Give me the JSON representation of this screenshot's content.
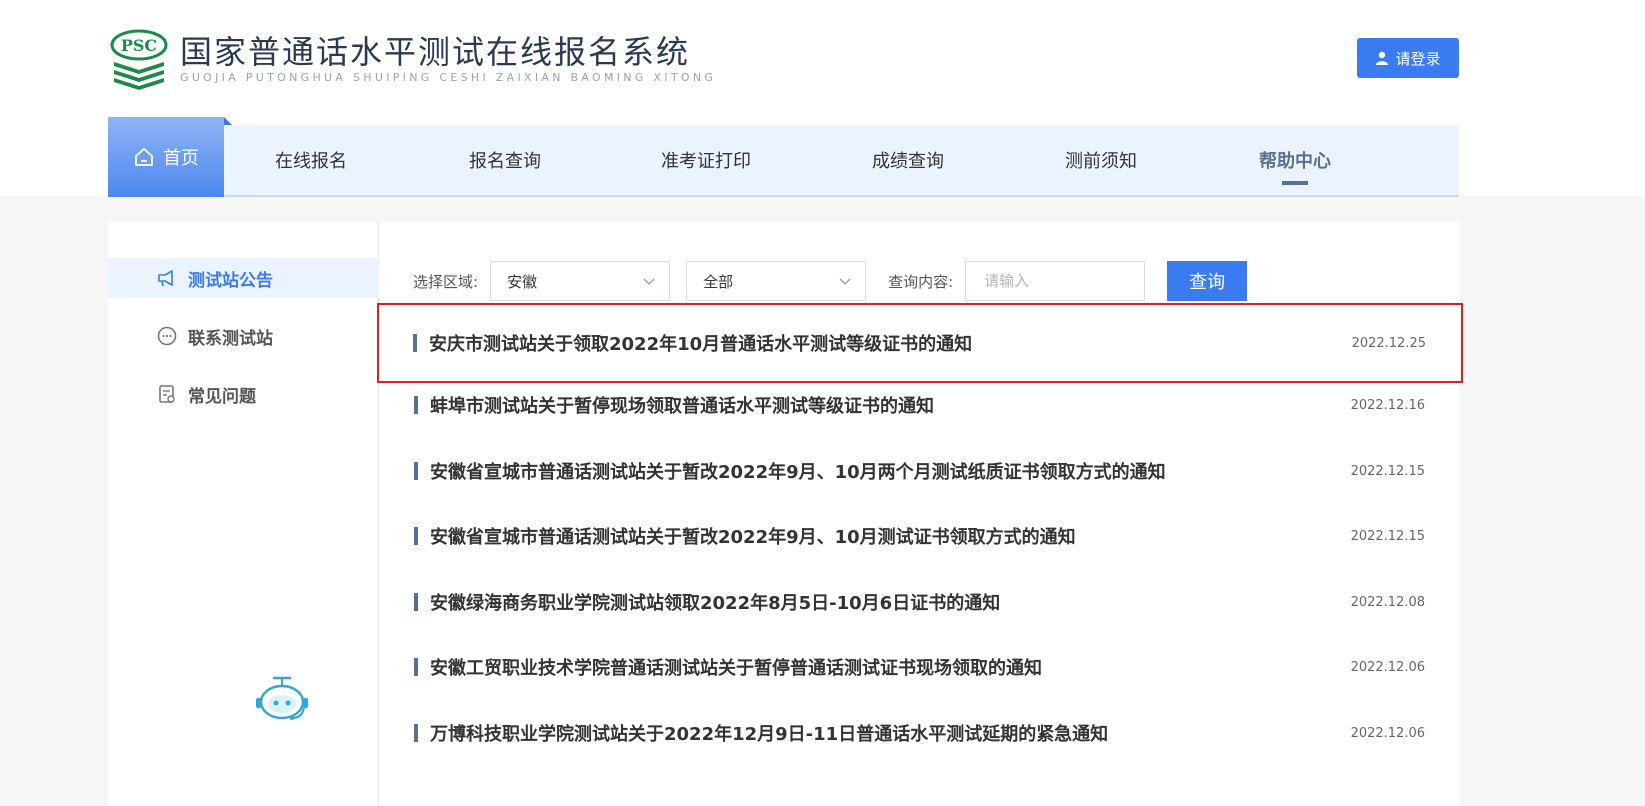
{
  "brand": {
    "logo_text": "PSC",
    "title": "国家普通话水平测试在线报名系统",
    "subtitle": "GUOJIA PUTONGHUA SHUIPING CESHI ZAIXIAN BAOMING XITONG"
  },
  "header": {
    "login_label": "请登录"
  },
  "nav": {
    "home_label": "首页",
    "items": [
      {
        "label": "在线报名"
      },
      {
        "label": "报名查询"
      },
      {
        "label": "准考证打印"
      },
      {
        "label": "成绩查询"
      },
      {
        "label": "测前须知"
      },
      {
        "label": "帮助中心"
      }
    ]
  },
  "sidebar": {
    "items": [
      {
        "label": "测试站公告",
        "icon": "megaphone-icon"
      },
      {
        "label": "联系测试站",
        "icon": "chat-icon"
      },
      {
        "label": "常见问题",
        "icon": "faq-document-icon"
      }
    ]
  },
  "filter": {
    "region_label": "选择区域:",
    "region_value": "安徽",
    "scope_value": "全部",
    "query_label": "查询内容:",
    "query_placeholder": "请输入",
    "search_label": "查询"
  },
  "notices": [
    {
      "title": "安庆市测试站关于领取2022年10月普通话水平测试等级证书的通知",
      "date": "2022.12.25"
    },
    {
      "title": "蚌埠市测试站关于暂停现场领取普通话水平测试等级证书的通知",
      "date": "2022.12.16"
    },
    {
      "title": "安徽省宣城市普通话测试站关于暂改2022年9月、10月两个月测试纸质证书领取方式的通知",
      "date": "2022.12.15"
    },
    {
      "title": "安徽省宣城市普通话测试站关于暂改2022年9月、10月测试证书领取方式的通知",
      "date": "2022.12.15"
    },
    {
      "title": "安徽绿海商务职业学院测试站领取2022年8月5日-10月6日证书的通知",
      "date": "2022.12.08"
    },
    {
      "title": "安徽工贸职业技术学院普通话测试站关于暂停普通话测试证书现场领取的通知",
      "date": "2022.12.06"
    },
    {
      "title": "万博科技职业学院测试站关于2022年12月9日-11日普通话水平测试延期的紧急通知",
      "date": "2022.12.06"
    }
  ],
  "colors": {
    "accent": "#3a7cf0",
    "nav_bg": "#eaf3ff",
    "highlight": "#e02020",
    "bar": "#5a6f91"
  }
}
